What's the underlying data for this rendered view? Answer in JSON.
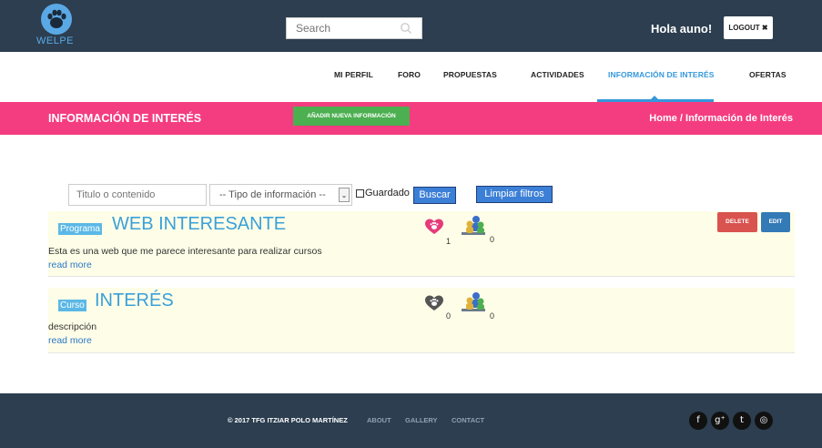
{
  "header": {
    "logo_text": "WELPE",
    "search_placeholder": "Search",
    "greeting": "Hola auno!",
    "logout_label": "LOGOUT ✖"
  },
  "nav": {
    "items": [
      {
        "label": "MI PERFIL"
      },
      {
        "label": "FORO"
      },
      {
        "label": "PROPUESTAS"
      },
      {
        "label": "ACTIVIDADES"
      },
      {
        "label": "INFORMACIÓN DE INTERÉS",
        "active": true
      },
      {
        "label": "OFERTAS"
      }
    ]
  },
  "section": {
    "title": "INFORMACIÓN DE INTERÉS",
    "add_button": "AÑADIR NUEVA INFORMACIÓN",
    "breadcrumb": "Home / Información de Interés"
  },
  "filters": {
    "text_placeholder": "Titulo o contenido",
    "type_select": "-- Tipo de información --",
    "saved_label": "Guardado",
    "search_button": "Buscar",
    "clear_button": "Limpiar filtros"
  },
  "items": [
    {
      "badge": "Programa",
      "title": "WEB INTERESANTE",
      "likes": "1",
      "participants": "0",
      "description": "Esta es una web que me parece interesante para realizar cursos",
      "read_more": "read more",
      "delete_label": "DELETE",
      "edit_label": "EDIT",
      "liked": true
    },
    {
      "badge": "Curso",
      "title": "INTERÉS",
      "likes": "0",
      "participants": "0",
      "description": "descripción",
      "read_more": "read more",
      "liked": false
    }
  ],
  "footer": {
    "copyright": "© 2017 TFG ITZIAR POLO MARTÍNEZ",
    "links": [
      "ABOUT",
      "GALLERY",
      "CONTACT"
    ],
    "social": [
      {
        "icon": "facebook-icon",
        "glyph": "f"
      },
      {
        "icon": "google-plus-icon",
        "glyph": "g⁺"
      },
      {
        "icon": "twitter-icon",
        "glyph": "t"
      },
      {
        "icon": "dribbble-icon",
        "glyph": "◎"
      }
    ]
  },
  "colors": {
    "header_bg": "#2c3e50",
    "accent_pink": "#f43d80",
    "accent_blue": "#3598db",
    "card_bg": "#fefee8"
  }
}
